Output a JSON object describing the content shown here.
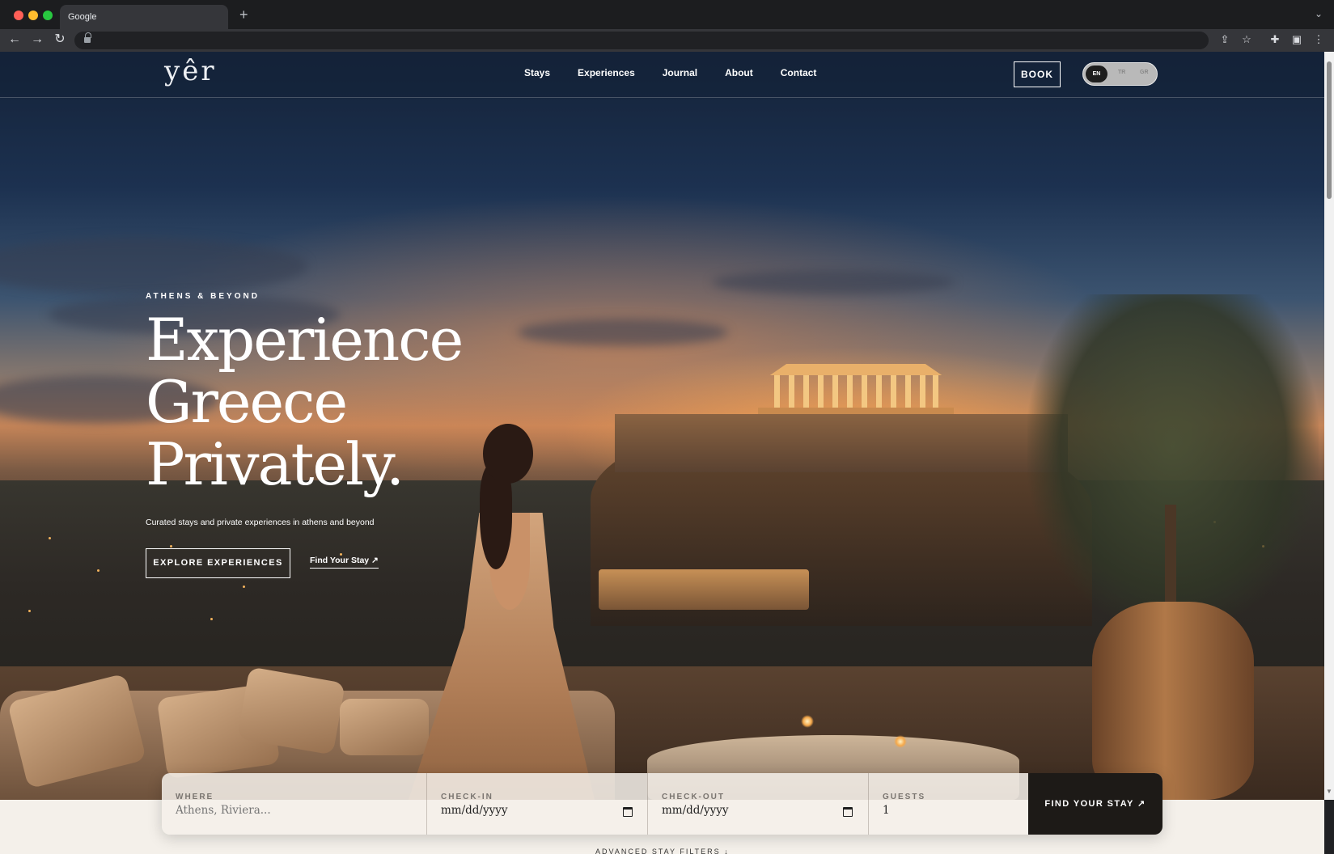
{
  "browser": {
    "tab_title": "Google",
    "new_tab_glyph": "+",
    "icons": [
      "back-arrow-icon",
      "forward-arrow-icon",
      "reload-icon",
      "lock-icon",
      "share-icon",
      "star-icon",
      "extensions-icon",
      "sidebar-icon",
      "more-icon"
    ]
  },
  "site": {
    "logo": "yêr",
    "nav": [
      "Stays",
      "Experiences",
      "Journal",
      "About",
      "Contact"
    ],
    "book_label": "BOOK",
    "languages": [
      "EN",
      "TR",
      "GR"
    ],
    "active_language": "EN"
  },
  "hero": {
    "eyebrow": "ATHENS & BEYOND",
    "headline_line1": "Experience",
    "headline_line2": "Greece",
    "headline_line3": "Privately.",
    "subtitle": "Curated stays and private experiences in athens and beyond",
    "cta_primary": "EXPLORE EXPERIENCES",
    "cta_secondary": "Find Your Stay ↗"
  },
  "search": {
    "where_label": "WHERE",
    "where_placeholder": "Athens, Riviera...",
    "checkin_label": "CHECK-IN",
    "checkin_value": "mm/dd/yyyy",
    "checkout_label": "CHECK-OUT",
    "checkout_value": "mm/dd/yyyy",
    "guests_label": "GUESTS",
    "guests_value": "1",
    "button_label": "FIND YOUR STAY ↗",
    "advanced_label": "ADVANCED STAY FILTERS ↓"
  },
  "colors": {
    "brand_dark": "#1d1a17",
    "cream": "#f4f0ea",
    "sky_top": "#142238",
    "sunset": "#c48458"
  }
}
